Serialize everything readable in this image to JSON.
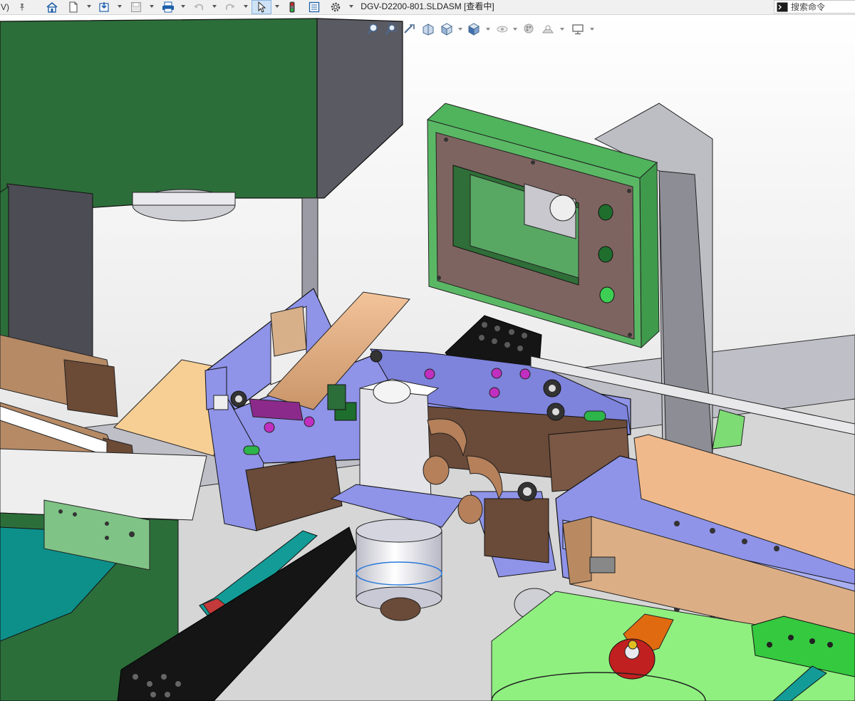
{
  "titlebar": {
    "partial_left_glyph": "V)",
    "document_title": "DGV-D2200-801.SLDASM [查看中]",
    "search_placeholder": "搜索命令",
    "toolbar_icons": [
      "pin-icon",
      "home-icon",
      "new-document-icon",
      "open-icon",
      "save-icon",
      "print-icon",
      "undo-icon",
      "redo-icon",
      "select-pointer-icon",
      "rebuild-traffic-light-icon",
      "file-properties-icon",
      "options-gear-icon"
    ]
  },
  "view_toolbar": {
    "icons": [
      "zoom-to-fit-icon",
      "zoom-to-area-icon",
      "previous-view-icon",
      "section-view-icon",
      "view-orientation-icon",
      "display-style-icon",
      "hide-show-items-icon",
      "edit-appearance-icon",
      "apply-scene-icon",
      "view-settings-icon"
    ]
  },
  "viewport": {
    "background_top": "#ffffff",
    "background_bottom": "#d9d9d9",
    "colors": {
      "green_frame": "#2c6e3a",
      "dark_gray": "#5a5a62",
      "lavender": "#8f94e8",
      "tan": "#d9a97c",
      "brown": "#6a4a38",
      "silver": "#d8d8d8",
      "teal": "#0d8f8a",
      "bright_green": "#8ff07f",
      "magenta": "#8c2a8c",
      "red_part": "#c02020",
      "orange_part": "#e06a10"
    }
  }
}
